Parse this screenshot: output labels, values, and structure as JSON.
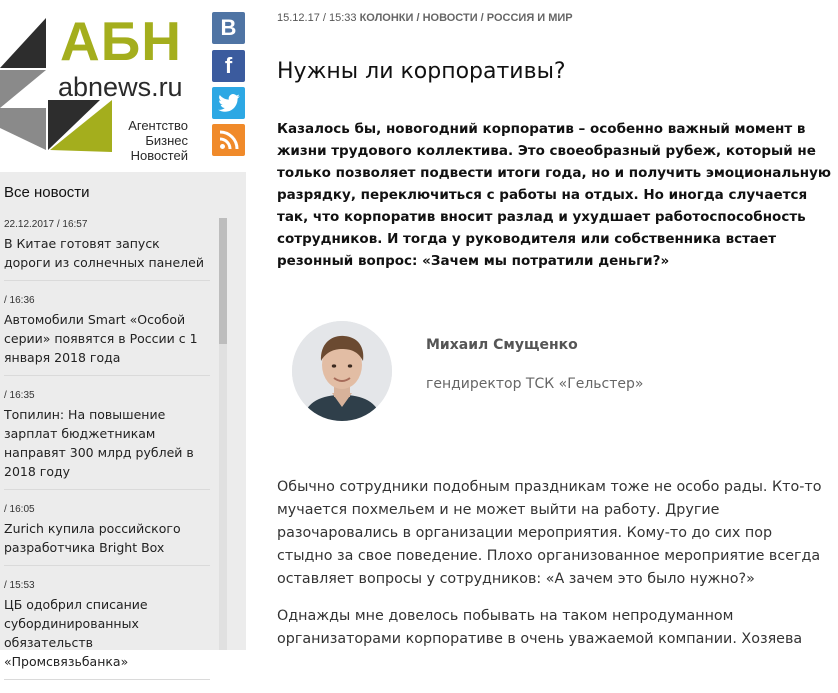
{
  "logo": {
    "letters": "АБН",
    "site": "abnews.ru",
    "tagline": [
      "Агентство",
      "Бизнес",
      "Новостей"
    ],
    "colors": {
      "accent": "#a4ae1d",
      "dark": "#2d2d2d",
      "gray": "#8a8a8a"
    }
  },
  "social": [
    {
      "name": "vk-icon",
      "glyph": "В",
      "color": "#4f74a4"
    },
    {
      "name": "facebook-icon",
      "glyph": "f",
      "color": "#3b5b9e"
    },
    {
      "name": "twitter-icon",
      "glyph": "twitter-bird",
      "color": "#2da8e4"
    },
    {
      "name": "rss-icon",
      "glyph": "rss",
      "color": "#f08a2a"
    }
  ],
  "sidebar": {
    "heading": "Все новости",
    "items": [
      {
        "time": "22.12.2017 / 16:57",
        "title": "В Китае готовят запуск дороги из солнечных панелей"
      },
      {
        "time": "/ 16:36",
        "title": "Автомобили Smart «Особой серии» появятся в России с 1 января 2018 года"
      },
      {
        "time": "/ 16:35",
        "title": "Топилин: На повышение зарплат бюджетникам направят 300 млрд рублей в 2018 году"
      },
      {
        "time": "/ 16:05",
        "title": "Zurich купила российского разработчика Bright Box"
      },
      {
        "time": "/ 15:53",
        "title": "ЦБ одобрил списание субординированных обязательств «Промсвязьбанка»"
      }
    ]
  },
  "article": {
    "datetime": "15.12.17 / 15:33",
    "categories": "КОЛОНКИ / НОВОСТИ / РОССИЯ И МИР",
    "title": "Нужны ли корпоративы?",
    "lead": "Казалось бы, новогодний корпоратив – особенно важный момент в жизни трудового коллектива. Это своеобразный рубеж, который не только позволяет подвести итоги года, но и получить эмоциональную разрядку, переключиться с работы на отдых. Но иногда случается так, что корпоратив вносит разлад и ухудшает работоспособность сотрудников. И тогда у руководителя или собственника встает резонный вопрос: «Зачем мы потратили деньги?»",
    "author": {
      "name": "Михаил Смущенко",
      "position": "гендиректор ТСК «Гельстер»"
    },
    "paragraphs": [
      "Обычно сотрудники подобным праздникам тоже не особо рады. Кто-то мучается похмельем и не может выйти на работу. Другие разочаровались в организации мероприятия. Кому-то до сих пор стыдно за свое поведение. Плохо организованное мероприятие всегда оставляет вопросы у сотрудников: «А зачем это было нужно?»",
      "Однажды мне довелось побывать на таком непродуманном организаторами корпоративе в очень уважаемой компании. Хозяева"
    ]
  }
}
